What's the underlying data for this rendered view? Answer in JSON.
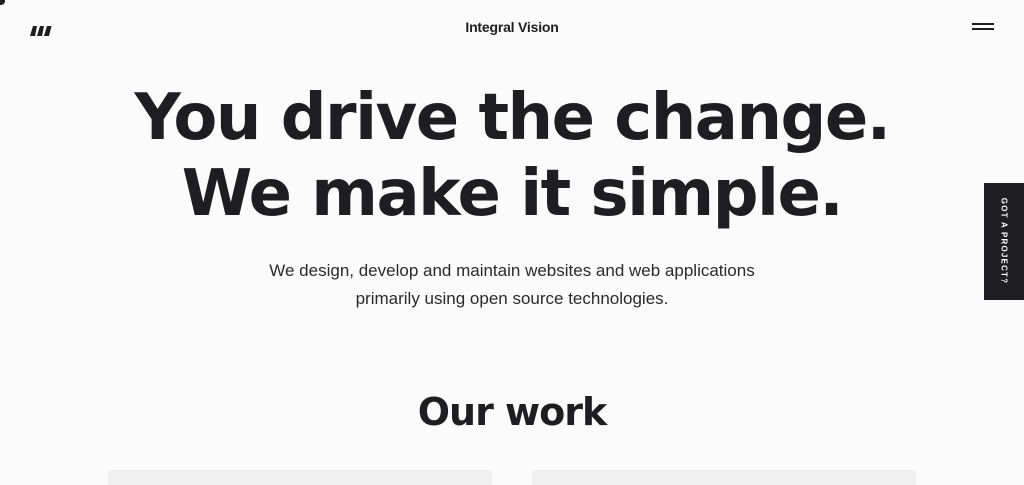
{
  "header": {
    "brand": "Integral Vision",
    "logo_icon": "brand-logo-icon",
    "menu_icon": "hamburger-menu-icon"
  },
  "hero": {
    "line1": "You drive the change.",
    "line2": "We make it simple."
  },
  "intro": {
    "line1": "We design, develop and maintain websites and web applications",
    "line2": "primarily using open source technologies."
  },
  "work": {
    "title": "Our work"
  },
  "cta": {
    "label": "GOT A PROJECT?"
  },
  "colors": {
    "background": "#fbfbfb",
    "text": "#1e1e20",
    "cta_background": "#1e1e20",
    "cta_text": "#ffffff",
    "card_placeholder": "#f0f0f0"
  }
}
